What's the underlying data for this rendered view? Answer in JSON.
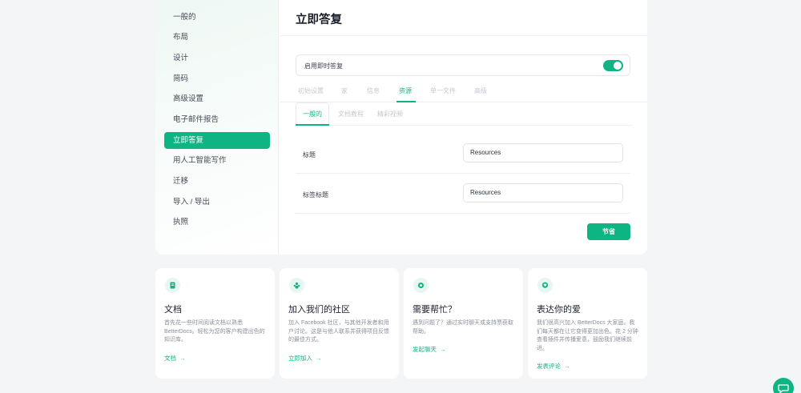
{
  "sidebar": {
    "items": [
      {
        "label": "一般的"
      },
      {
        "label": "布局"
      },
      {
        "label": "设计"
      },
      {
        "label": "简码"
      },
      {
        "label": "高级设置"
      },
      {
        "label": "电子邮件报告"
      },
      {
        "label": "立即答复",
        "active": true
      },
      {
        "label": "用人工智能写作"
      },
      {
        "label": "迁移"
      },
      {
        "label": "导入 / 导出"
      },
      {
        "label": "执照"
      }
    ]
  },
  "main": {
    "title": "立即答复",
    "toggle": {
      "label": "启用即时答复",
      "enabled": true
    },
    "tabs": [
      {
        "label": "初始设置"
      },
      {
        "label": "家"
      },
      {
        "label": "信息"
      },
      {
        "label": "资源",
        "active": true
      },
      {
        "label": "单一文件"
      },
      {
        "label": "高级"
      }
    ],
    "subtabs": [
      {
        "label": "一般的",
        "active": true
      },
      {
        "label": "文档教程"
      },
      {
        "label": "精彩视频"
      }
    ],
    "fields": [
      {
        "label": "标题",
        "value": "Resources"
      },
      {
        "label": "标签标题",
        "value": "Resources"
      }
    ],
    "save_label": "节省"
  },
  "cards": [
    {
      "icon": "document-icon",
      "title": "文档",
      "text": "首先花一些时间阅读文档以熟悉 BetterDocs。轻松为您的客户构建出色的知识库。",
      "link": "文档"
    },
    {
      "icon": "community-icon",
      "title": "加入我们的社区",
      "text": "加入 Facebook 社区，与其他开发者和用户讨论。这是与他人联系并获得项目反馈的最佳方式。",
      "link": "立即加入"
    },
    {
      "icon": "support-icon",
      "title": "需要帮忙？",
      "text": "遇到问题了？通过实时聊天或支持票获取帮助。",
      "link": "发起聊天"
    },
    {
      "icon": "heart-chat-icon",
      "title": "表达你的爱",
      "text": "我们很高兴加入 BetterDocs 大家庭。我们每天都在让它变得更加出色。花 2 分钟查看插件并传播爱意，鼓励我们继续前进。",
      "link": "发表评论"
    }
  ],
  "colors": {
    "accent": "#0eb582",
    "background": "#f4f5f7"
  }
}
